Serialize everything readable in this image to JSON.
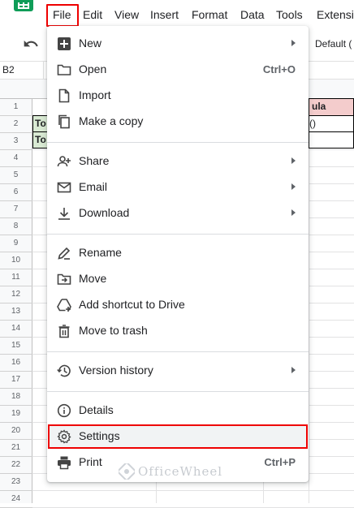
{
  "app": {
    "title": "_",
    "menus": [
      "File",
      "Edit",
      "View",
      "Insert",
      "Format",
      "Data",
      "Tools",
      "Extensi"
    ]
  },
  "toolbar": {
    "font": "Default ("
  },
  "formula_bar": {
    "name_box": "B2"
  },
  "grid": {
    "rows": [
      "1",
      "2",
      "3",
      "4",
      "5",
      "6",
      "7",
      "8",
      "9",
      "10",
      "11",
      "12",
      "13",
      "14",
      "15",
      "16",
      "17",
      "18",
      "19",
      "20",
      "21",
      "22",
      "23",
      "24"
    ],
    "cells": {
      "b2": "To",
      "b3": "To",
      "e1": "ula",
      "e2": "()"
    }
  },
  "file_menu": {
    "items": [
      {
        "label": "New",
        "icon": "plus-square-icon",
        "submenu": true
      },
      {
        "label": "Open",
        "icon": "folder-icon",
        "shortcut": "Ctrl+O"
      },
      {
        "label": "Import",
        "icon": "file-icon"
      },
      {
        "label": "Make a copy",
        "icon": "copy-icon"
      },
      {
        "label": "Share",
        "icon": "person-add-icon",
        "submenu": true
      },
      {
        "label": "Email",
        "icon": "mail-icon",
        "submenu": true
      },
      {
        "label": "Download",
        "icon": "download-icon",
        "submenu": true
      },
      {
        "label": "Rename",
        "icon": "pencil-icon"
      },
      {
        "label": "Move",
        "icon": "folder-move-icon"
      },
      {
        "label": "Add shortcut to Drive",
        "icon": "drive-add-icon"
      },
      {
        "label": "Move to trash",
        "icon": "trash-icon"
      },
      {
        "label": "Version history",
        "icon": "history-icon",
        "submenu": true
      },
      {
        "label": "Details",
        "icon": "info-icon"
      },
      {
        "label": "Settings",
        "icon": "gear-icon",
        "highlighted": true
      },
      {
        "label": "Print",
        "icon": "printer-icon",
        "shortcut": "Ctrl+P"
      }
    ]
  },
  "watermark": "OfficeWheel",
  "colors": {
    "highlight_border": "#ee0000",
    "sheets_green": "#0f9d58",
    "cell_green": "#d9ead3",
    "cell_pink": "#f4cccc"
  }
}
